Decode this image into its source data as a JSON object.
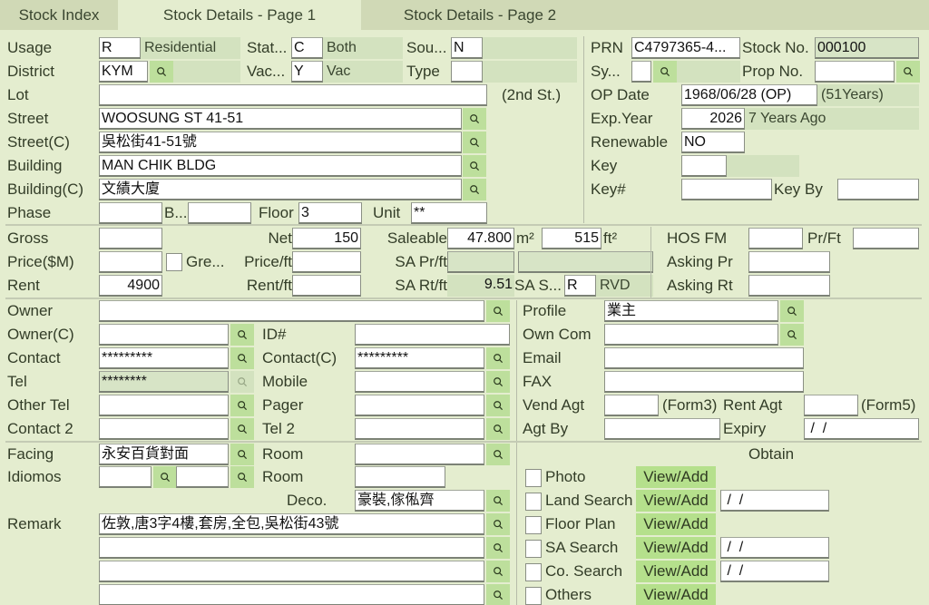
{
  "tabs": [
    {
      "label": "Stock Index",
      "active": false
    },
    {
      "label": "Stock Details - Page 1",
      "active": true
    },
    {
      "label": "Stock Details - Page 2",
      "active": false
    }
  ],
  "property": {
    "usage": {
      "label": "Usage",
      "code": "R",
      "desc": "Residential"
    },
    "status": {
      "label": "Stat...",
      "code": "C",
      "desc": "Both"
    },
    "source": {
      "label": "Sou...",
      "code": "N",
      "desc": ""
    },
    "district": {
      "label": "District",
      "code": "KYM"
    },
    "vacancy": {
      "label": "Vac...",
      "code": "Y",
      "desc": "Vac"
    },
    "type": {
      "label": "Type",
      "code": ""
    },
    "lot": {
      "label": "Lot",
      "value": "",
      "note": "(2nd St.)"
    },
    "street": {
      "label": "Street",
      "value": "WOOSUNG ST 41-51"
    },
    "street_c": {
      "label": "Street(C)",
      "value": "吳松街41-51號"
    },
    "building": {
      "label": "Building",
      "value": "MAN CHIK BLDG"
    },
    "building_c": {
      "label": "Building(C)",
      "value": "文績大廈"
    },
    "phase": {
      "label": "Phase",
      "value": ""
    },
    "block": {
      "label": "B...",
      "value": ""
    },
    "floor": {
      "label": "Floor",
      "value": "3"
    },
    "unit": {
      "label": "Unit",
      "value": "**"
    }
  },
  "right_info": {
    "prn": {
      "label": "PRN",
      "value": "C4797365-4..."
    },
    "stock_no": {
      "label": "Stock No.",
      "value": "000100"
    },
    "sy": {
      "label": "Sy...",
      "value": ""
    },
    "prop_no": {
      "label": "Prop No.",
      "value": ""
    },
    "op_date": {
      "label": "OP Date",
      "value": "1968/06/28 (OP)",
      "age": "(51Years)"
    },
    "exp_year": {
      "label": "Exp.Year",
      "value": "2026",
      "note": "7 Years Ago"
    },
    "renewable": {
      "label": "Renewable",
      "value": "NO"
    },
    "key": {
      "label": "Key",
      "value": ""
    },
    "key_no": {
      "label": "Key#",
      "value": ""
    },
    "key_by": {
      "label": "Key By",
      "value": ""
    }
  },
  "area": {
    "gross": {
      "label": "Gross",
      "value": ""
    },
    "net": {
      "label": "Net",
      "value": "150"
    },
    "saleable": {
      "label": "Saleable",
      "m2": "47.800",
      "m2_unit": "m²",
      "ft2": "515",
      "ft2_unit": "ft²"
    },
    "price": {
      "label": "Price($M)",
      "value": ""
    },
    "gre": {
      "label": "Gre...",
      "checked": false
    },
    "price_ft": {
      "label": "Price/ft",
      "value": ""
    },
    "sa_pr_ft": {
      "label": "SA Pr/ft",
      "value": "",
      "extra": ""
    },
    "rent": {
      "label": "Rent",
      "value": "4900"
    },
    "rent_ft": {
      "label": "Rent/ft",
      "value": ""
    },
    "sa_rt_ft": {
      "label": "SA Rt/ft",
      "value": "9.51"
    },
    "sa_s": {
      "label": "SA S...",
      "code": "R",
      "desc": "RVD"
    },
    "hos_fm": {
      "label": "HOS FM",
      "value": ""
    },
    "pr_ft": {
      "label": "Pr/Ft",
      "value": ""
    },
    "asking_pr": {
      "label": "Asking Pr",
      "value": ""
    },
    "asking_rt": {
      "label": "Asking Rt",
      "value": ""
    }
  },
  "owner": {
    "owner": {
      "label": "Owner",
      "value": ""
    },
    "owner_c": {
      "label": "Owner(C)",
      "value": ""
    },
    "id_no": {
      "label": "ID#",
      "value": ""
    },
    "contact": {
      "label": "Contact",
      "value": "*********"
    },
    "contact_c": {
      "label": "Contact(C)",
      "value": "*********"
    },
    "tel": {
      "label": "Tel",
      "value": "********"
    },
    "mobile": {
      "label": "Mobile",
      "value": ""
    },
    "other_tel": {
      "label": "Other Tel",
      "value": ""
    },
    "pager": {
      "label": "Pager",
      "value": ""
    },
    "contact2": {
      "label": "Contact 2",
      "value": ""
    },
    "tel2": {
      "label": "Tel 2",
      "value": ""
    },
    "profile": {
      "label": "Profile",
      "value": "業主"
    },
    "own_com": {
      "label": "Own Com",
      "value": ""
    },
    "email": {
      "label": "Email",
      "value": ""
    },
    "fax": {
      "label": "FAX",
      "value": ""
    },
    "vend_agt": {
      "label": "Vend Agt",
      "value": "",
      "note": "(Form3)"
    },
    "rent_agt": {
      "label": "Rent Agt",
      "value": "",
      "note": "(Form5)"
    },
    "agt_by": {
      "label": "Agt By",
      "value": ""
    },
    "expiry": {
      "label": "Expiry",
      "value": " /  /"
    }
  },
  "misc": {
    "facing": {
      "label": "Facing",
      "value": "永安百貨對面"
    },
    "idiomos": {
      "label": "Idiomos",
      "value1": "",
      "value2": ""
    },
    "room1": {
      "label": "Room",
      "value": ""
    },
    "room2": {
      "label": "Room",
      "value": ""
    },
    "deco": {
      "label": "Deco.",
      "value": "豪裝,傢俬齊"
    },
    "remark": {
      "label": "Remark",
      "lines": [
        "佐敦,唐3字4樓,套房,全包,吳松街43號",
        "",
        "",
        ""
      ]
    }
  },
  "obtain": {
    "header": "Obtain",
    "button_label": "View/Add",
    "items": [
      {
        "label": "Photo",
        "checked": false,
        "date": null
      },
      {
        "label": "Land Search",
        "checked": false,
        "date": " /  /"
      },
      {
        "label": "Floor Plan",
        "checked": false,
        "date": null
      },
      {
        "label": "SA Search",
        "checked": false,
        "date": " /  /"
      },
      {
        "label": "Co. Search",
        "checked": false,
        "date": " /  /"
      },
      {
        "label": "Others",
        "checked": false,
        "date": null
      }
    ]
  },
  "icons": {
    "search": "magnifier-icon"
  }
}
